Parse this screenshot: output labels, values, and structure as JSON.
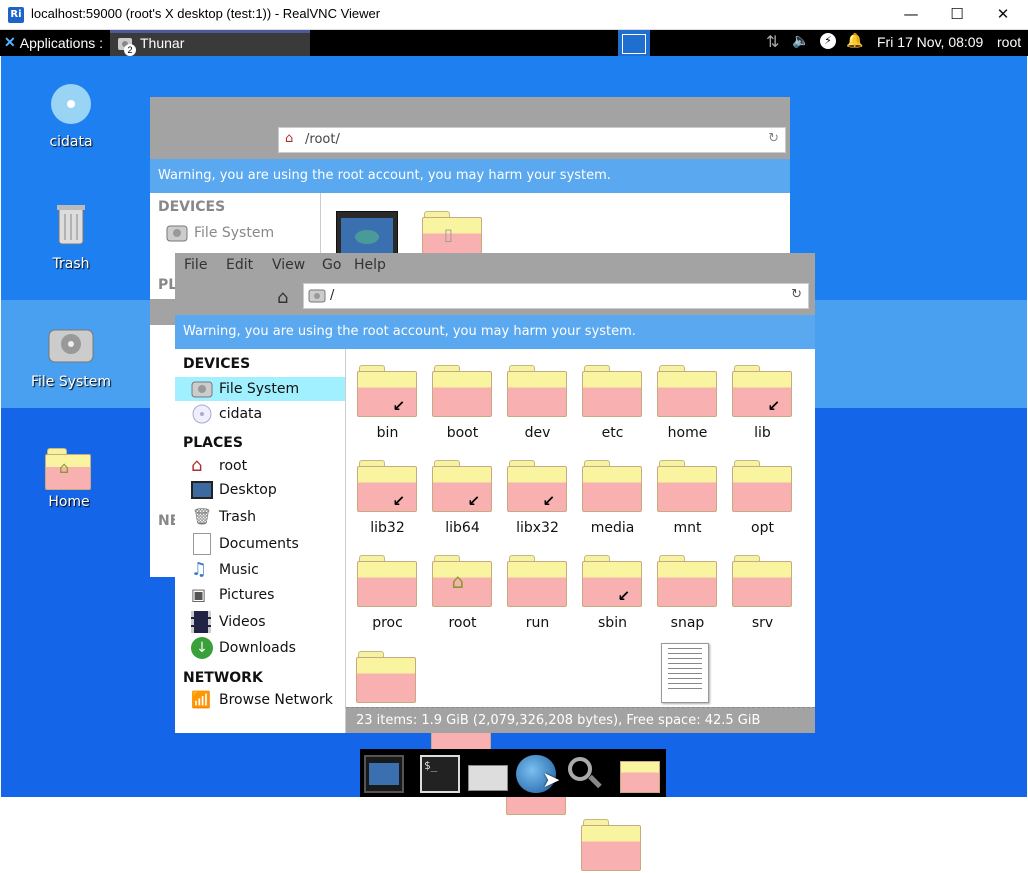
{
  "vnc": {
    "title": "localhost:59000 (root's X desktop (test:1)) - RealVNC Viewer",
    "logo": "Ri",
    "min": "—",
    "max": "☐",
    "close": "✕"
  },
  "panel": {
    "apps_label": "Applications :",
    "task_label": "Thunar",
    "task_badge": "2",
    "clock": "Fri 17 Nov, 08:09",
    "user": "root"
  },
  "desktop_icons": [
    {
      "label": "cidata"
    },
    {
      "label": "Trash"
    },
    {
      "label": "File System"
    },
    {
      "label": "Home"
    }
  ],
  "back_window": {
    "address": "/root/",
    "warning": "Warning, you are using the root account, you may harm your system.",
    "devices": "DEVICES",
    "file_system": "File System",
    "places_partial": "PL",
    "network_partial": "NE"
  },
  "front_window": {
    "menu": [
      "File",
      "Edit",
      "View",
      "Go",
      "Help"
    ],
    "address": "/",
    "warning": "Warning, you are using the root account, you may harm your system.",
    "sidebar": {
      "devices": "DEVICES",
      "places": "PLACES",
      "network": "NETWORK",
      "device_items": [
        "File System",
        "cidata"
      ],
      "place_items": [
        "root",
        "Desktop",
        "Trash",
        "Documents",
        "Music",
        "Pictures",
        "Videos",
        "Downloads"
      ],
      "network_items": [
        "Browse Network"
      ]
    },
    "files": [
      "bin",
      "boot",
      "dev",
      "etc",
      "home",
      "lib",
      "lib32",
      "lib64",
      "libx32",
      "media",
      "mnt",
      "opt",
      "proc",
      "root",
      "run",
      "sbin",
      "snap",
      "srv"
    ],
    "status": "23 items: 1.9 GiB (2,079,326,208 bytes), Free space: 42.5 GiB"
  },
  "colors": {
    "accent": "#5aa8f0",
    "selection": "#a0f0ff",
    "panel": "#000000"
  }
}
